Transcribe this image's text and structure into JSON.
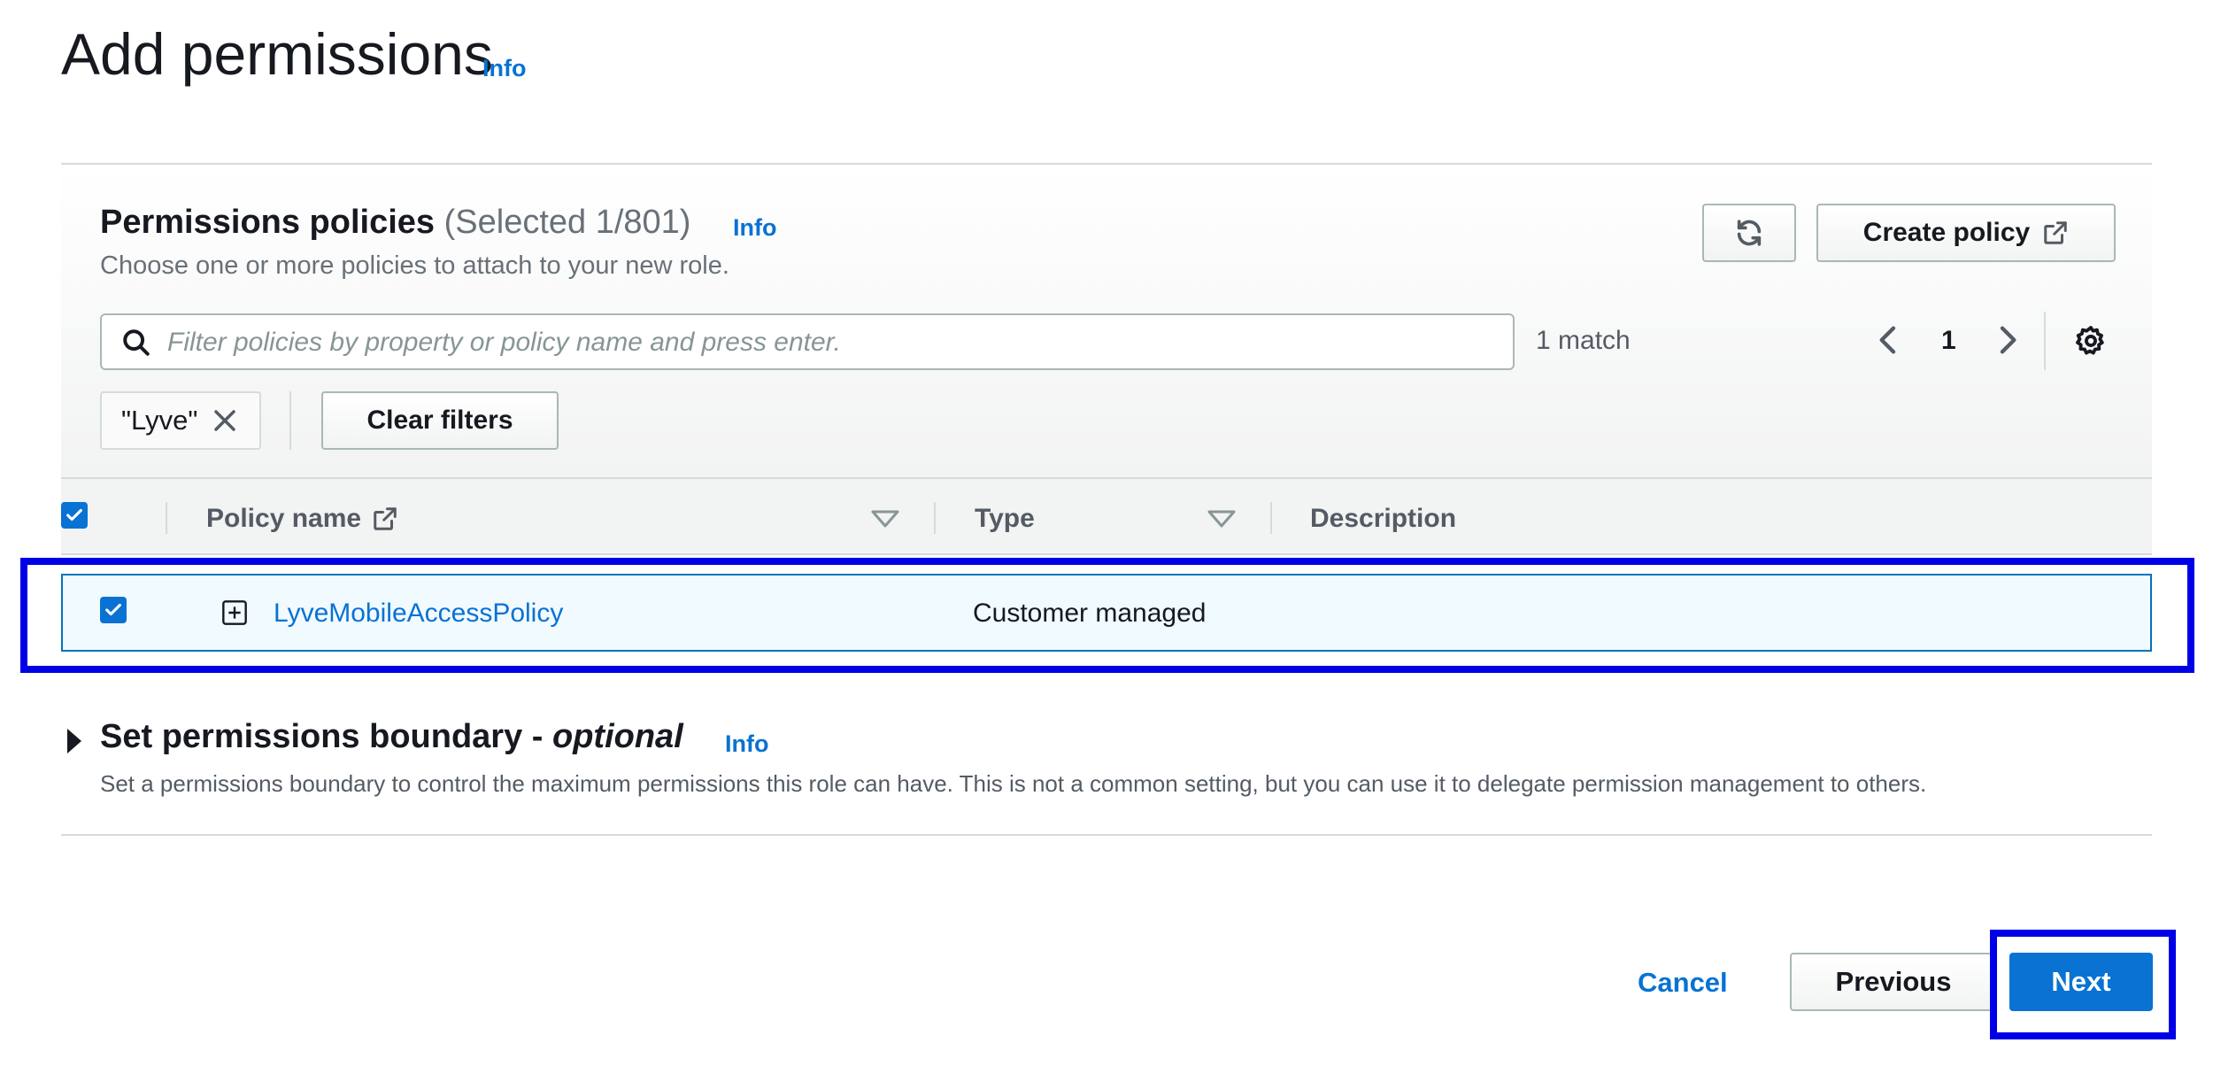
{
  "header": {
    "title": "Add permissions",
    "info_label": "Info"
  },
  "policies_panel": {
    "title": "Permissions policies",
    "selected_count": "(Selected 1/801)",
    "info_label": "Info",
    "description": "Choose one or more policies to attach to your new role.",
    "refresh_icon": "refresh-icon",
    "create_policy_label": "Create policy",
    "filter_placeholder": "Filter policies by property or policy name and press enter.",
    "match_count": "1 match",
    "current_page": "1",
    "active_filter": "\"Lyve\"",
    "clear_filters_label": "Clear filters",
    "columns": [
      "Policy name",
      "Type",
      "Description"
    ],
    "rows": [
      {
        "checked": true,
        "name": "LyveMobileAccessPolicy",
        "type": "Customer managed",
        "description": ""
      }
    ]
  },
  "boundary": {
    "title": "Set permissions boundary - ",
    "title_optional": "optional",
    "info_label": "Info",
    "description": "Set a permissions boundary to control the maximum permissions this role can have. This is not a common setting, but you can use it to delegate permission management to others."
  },
  "footer": {
    "cancel_label": "Cancel",
    "previous_label": "Previous",
    "next_label": "Next"
  },
  "colors": {
    "link": "#0972d3",
    "highlight": "#0000e6",
    "selected_row_bg": "#f1faff"
  }
}
